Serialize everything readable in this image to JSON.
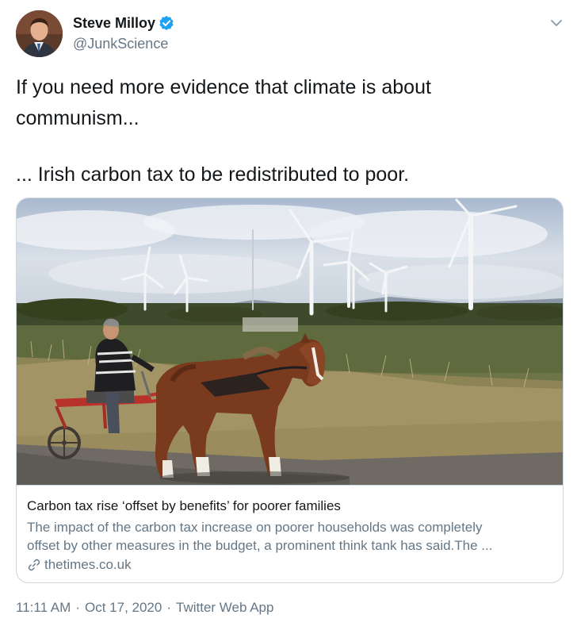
{
  "author": {
    "display_name": "Steve Milloy",
    "handle": "@JunkScience",
    "verified": true,
    "avatar_icon": "user-avatar"
  },
  "tweet": {
    "lines": [
      "If you need more evidence that climate is about",
      "communism...",
      "... Irish carbon tax to be redistributed to poor."
    ]
  },
  "card": {
    "image_icon": "photo-man-driving-pony-cart-wind-turbines",
    "title": "Carbon tax rise ‘offset by benefits’ for poorer families",
    "description_lines": [
      "The impact of the carbon tax increase on poorer households was completely",
      "offset by other measures in the budget, a prominent think tank has said.The ..."
    ],
    "domain": "thetimes.co.uk",
    "link_icon": "link-icon"
  },
  "meta": {
    "time": "11:11 AM",
    "date": "Oct 17, 2020",
    "source": "Twitter Web App",
    "separator": "·"
  },
  "colors": {
    "primary_text": "#14171a",
    "secondary_text": "#657786",
    "verified_blue": "#1da1f2",
    "border": "#ccd6dd"
  }
}
